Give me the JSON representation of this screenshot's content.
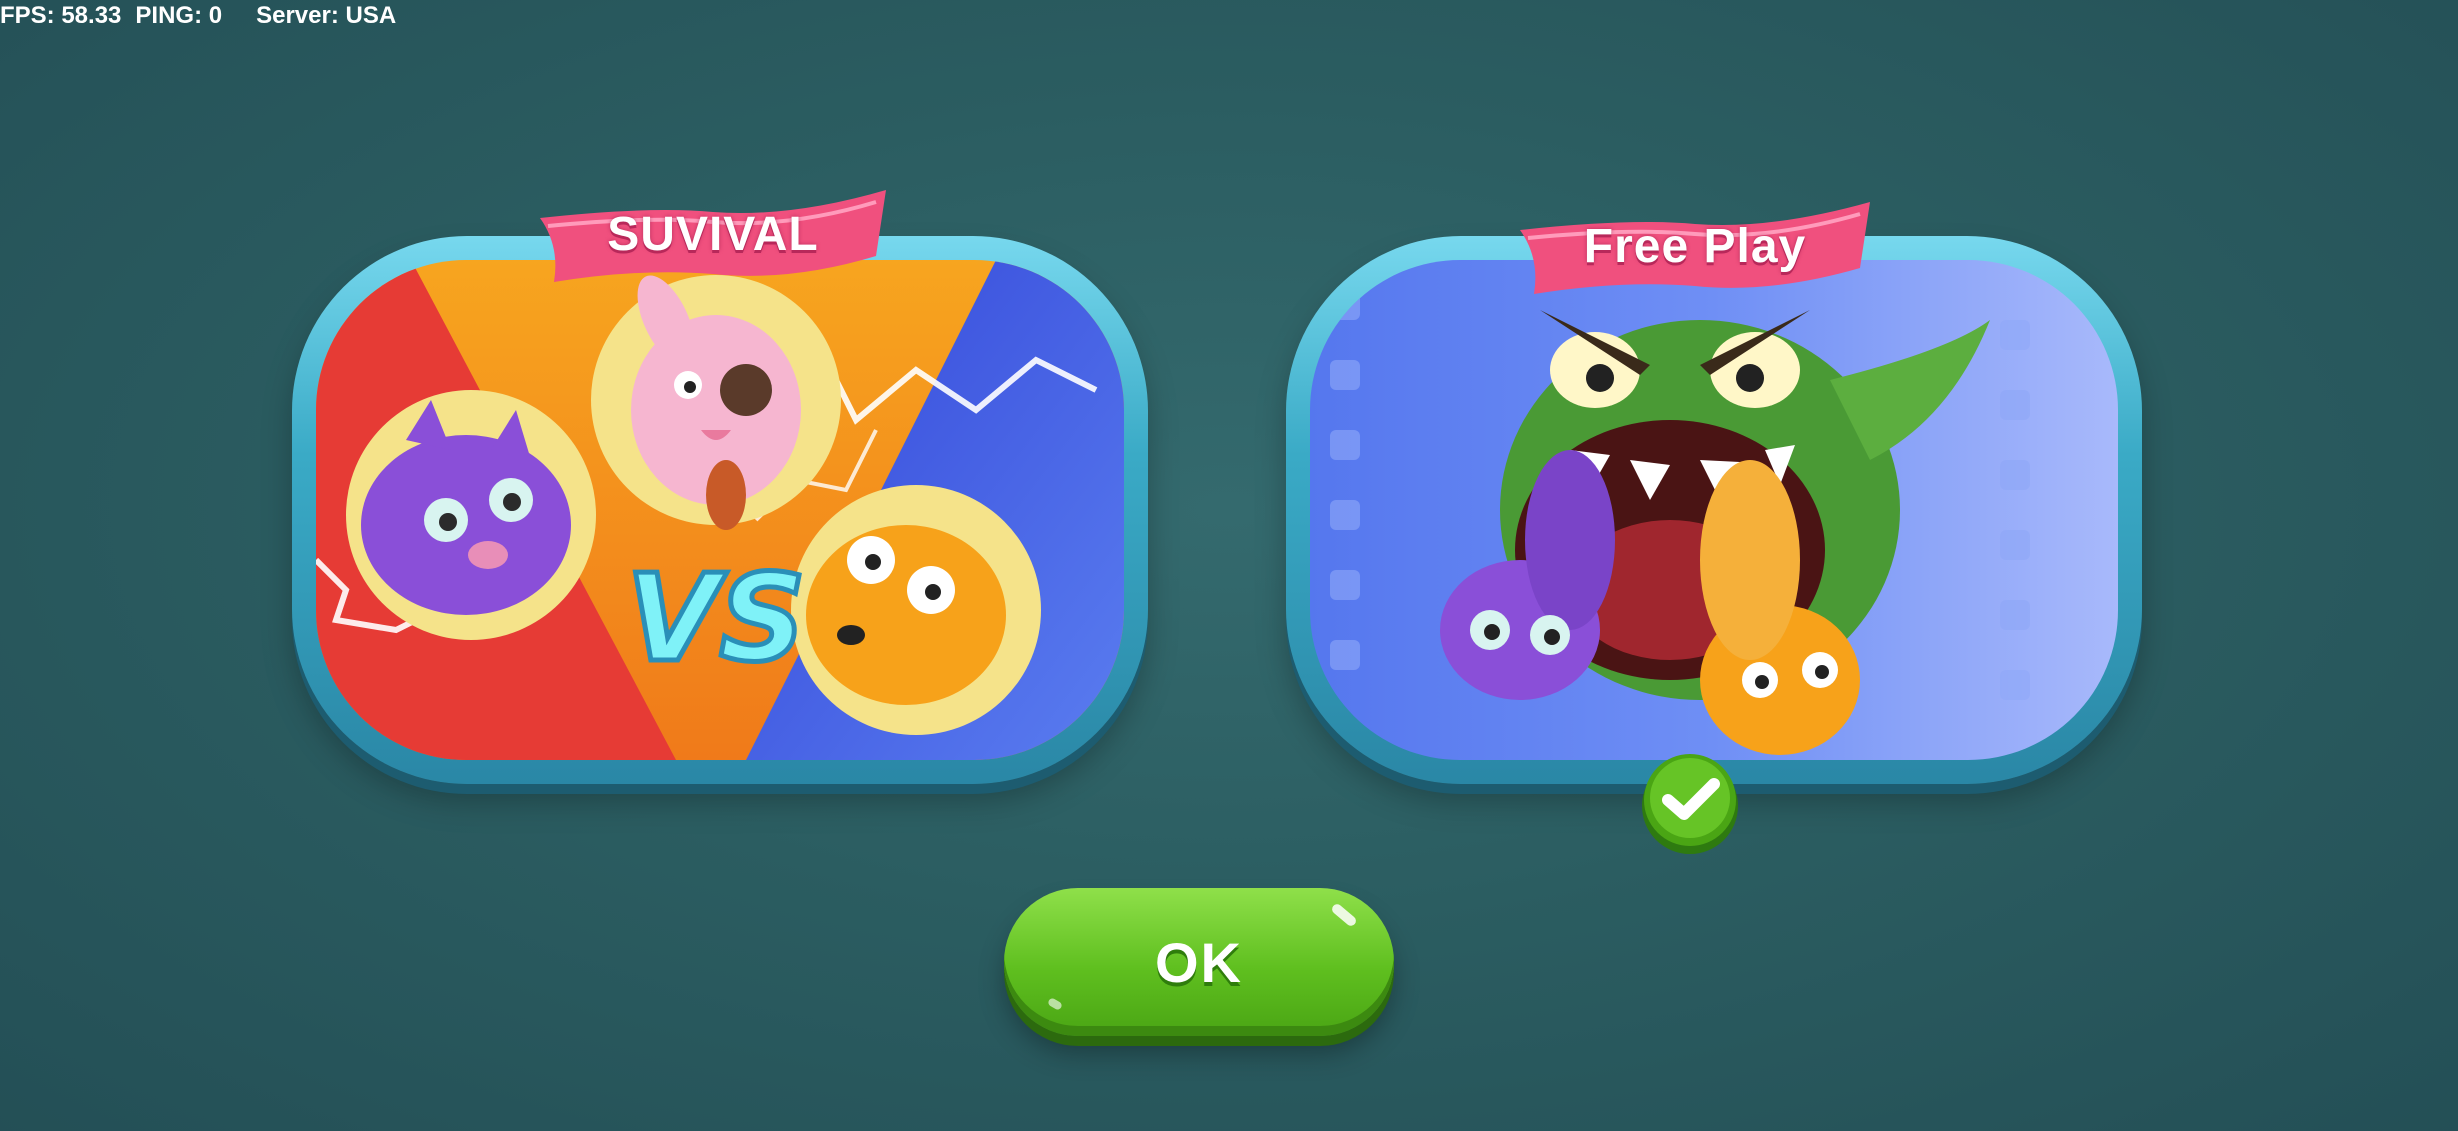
{
  "hud": {
    "fps": "FPS: 58.33",
    "ping": "PING: 0",
    "server": "Server: USA"
  },
  "modes": [
    {
      "label": "SUVIVAL",
      "selected": false
    },
    {
      "label": "Free Play",
      "selected": true
    }
  ],
  "survival_art": {
    "vs_text": "VS"
  },
  "ok_button": {
    "label": "OK"
  },
  "colors": {
    "background": "#2b5d61",
    "card_frame": "#3aaac6",
    "ribbon": "#f0507e",
    "ok_button": "#5fbf1f",
    "check_badge": "#4aa514"
  },
  "icons": [
    "check-icon"
  ]
}
